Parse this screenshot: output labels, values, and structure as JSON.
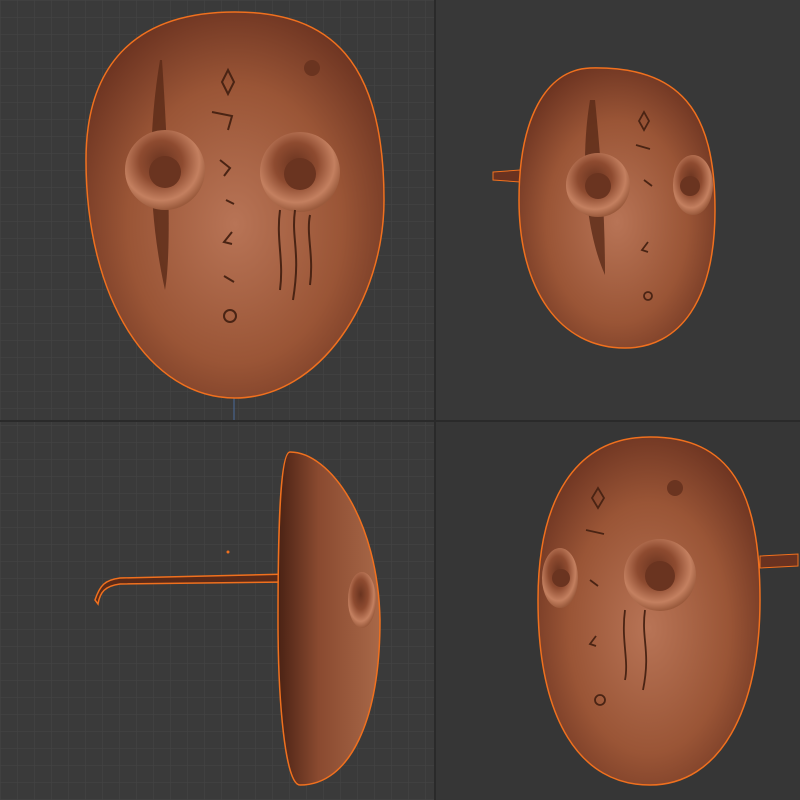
{
  "viewports": [
    {
      "id": "front",
      "view": "front-ortho"
    },
    {
      "id": "perspective-left",
      "view": "perspective"
    },
    {
      "id": "side",
      "view": "side-ortho"
    },
    {
      "id": "perspective-right",
      "view": "perspective"
    }
  ],
  "colors": {
    "background": "#393939",
    "grid_line": "#444444",
    "mask_base": "#8c4a2e",
    "mask_highlight": "#b06a48",
    "mask_shadow": "#5a2a18",
    "selection_outline": "#f0701e",
    "runes": "#4a2414"
  },
  "object": {
    "name_icon": "mask-mesh",
    "selected": true
  }
}
